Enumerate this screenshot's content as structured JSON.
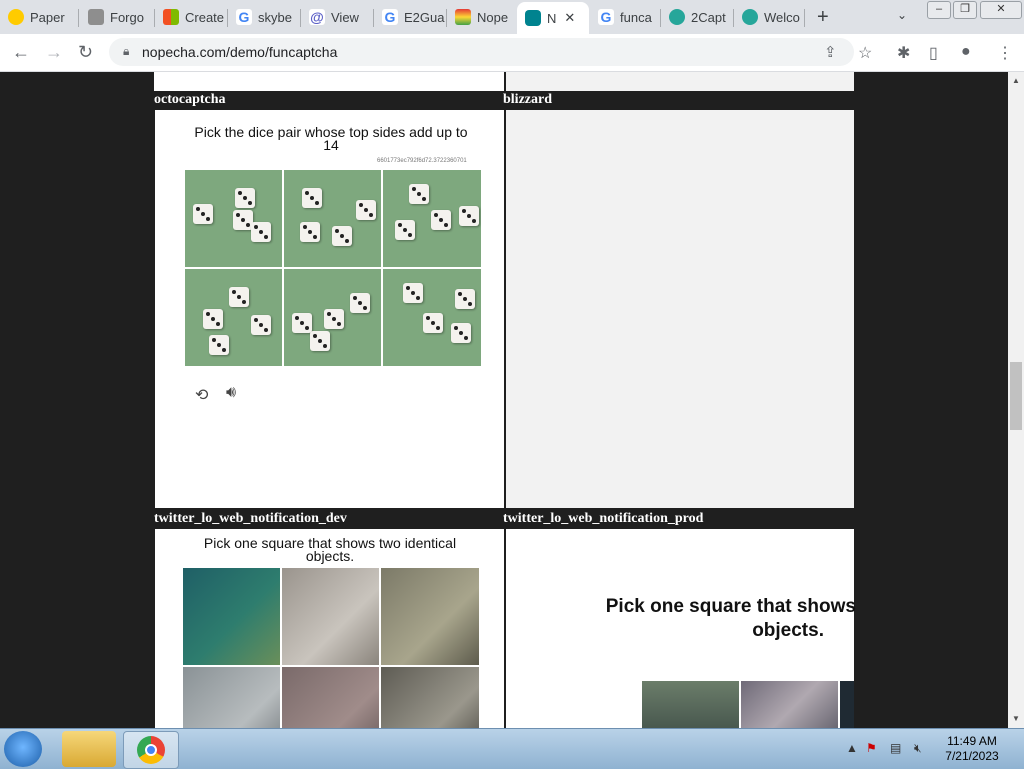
{
  "browser": {
    "tabs": [
      {
        "label": "Paper",
        "color": "#1a1a1a"
      },
      {
        "label": "Forgo",
        "color": "#8e8e8e"
      },
      {
        "label": "Create",
        "color": "#f25022"
      },
      {
        "label": "skybe",
        "color": "#4285f4"
      },
      {
        "label": "View",
        "color": "#5b5fc7"
      },
      {
        "label": "E2Gua",
        "color": "#4285f4"
      },
      {
        "label": "Nope",
        "color": "#e53935"
      },
      {
        "label": "N",
        "color": "#00838f"
      },
      {
        "label": "funca",
        "color": "#4285f4"
      },
      {
        "label": "2Capt",
        "color": "#26a69a"
      },
      {
        "label": "Welco",
        "color": "#26a69a"
      }
    ],
    "active_tab_index": 7,
    "url": "nopecha.com/demo/funcaptcha"
  },
  "page": {
    "row1_labels": {
      "left": "octocaptcha",
      "right": "blizzard"
    },
    "octo_captcha": {
      "prompt": "Pick the dice pair whose top sides add up to 14",
      "session_id": "6601773ec792f6d72.3722360701",
      "tiles": 6
    },
    "row2_labels": {
      "left": "twitter_lo_web_notification_dev",
      "right": "twitter_lo_web_notification_prod"
    },
    "twitter_dev": {
      "prompt": "Pick one square that shows two identical objects.",
      "tiles": 6
    },
    "twitter_prod": {
      "prompt_line1": "Pick one square that shows",
      "prompt_line2": "objects."
    }
  },
  "taskbar": {
    "time": "11:49 AM",
    "date": "7/21/2023"
  }
}
